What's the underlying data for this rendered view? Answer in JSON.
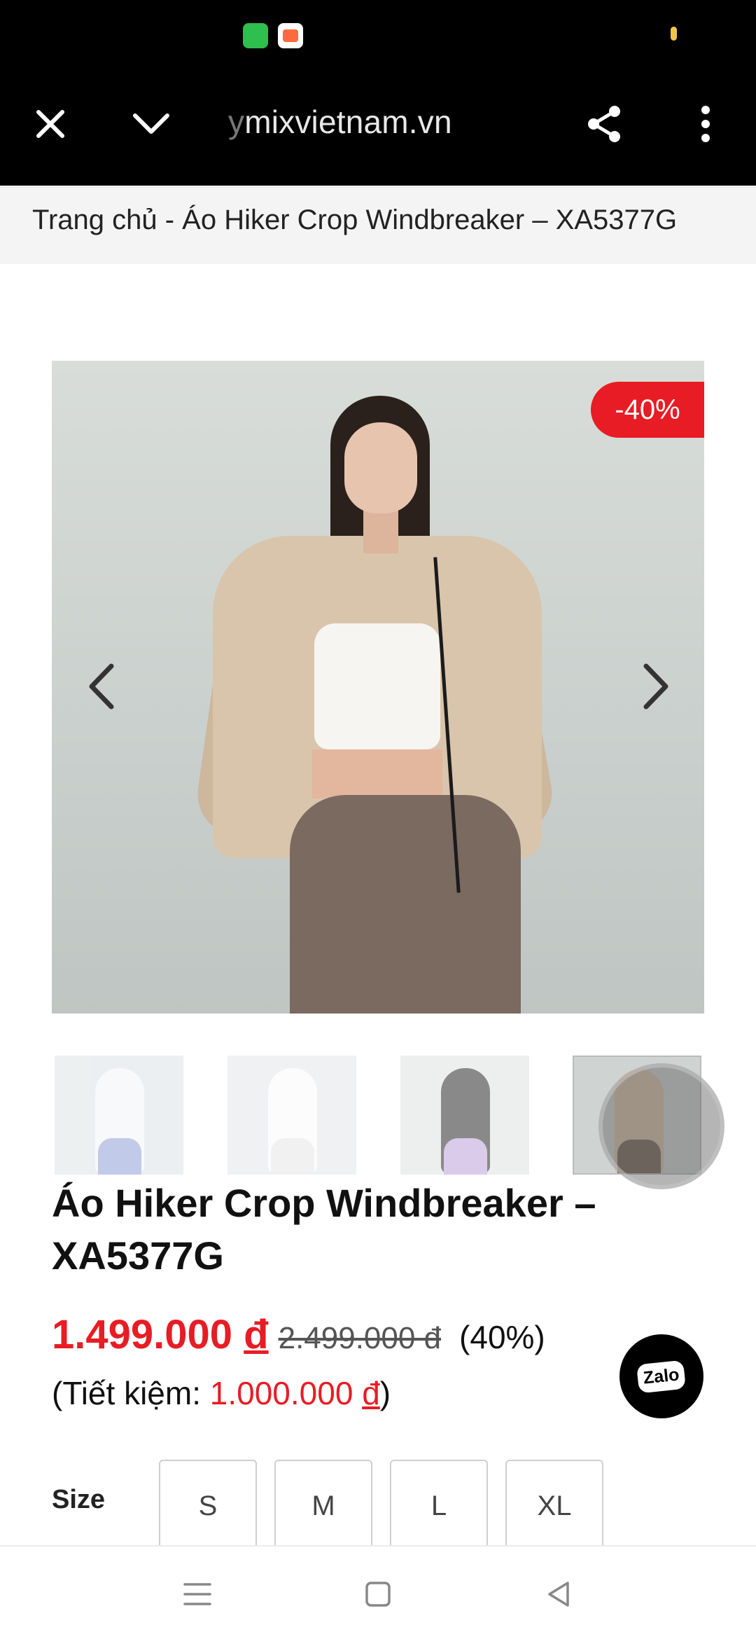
{
  "browser": {
    "url_faded": "y",
    "url_main": "mixvietnam.vn",
    "icons": [
      "close-icon",
      "chevron-down-icon",
      "share-icon",
      "more-vert-icon"
    ]
  },
  "breadcrumb": "Trang chủ - Áo Hiker Crop Windbreaker – XA5377G",
  "gallery": {
    "discount_badge": "-40%",
    "thumbnail_count": 4,
    "active_thumbnail": 4
  },
  "product": {
    "title_line1": "Áo Hiker Crop Windbreaker –",
    "title_line2": "XA5377G",
    "price_new": "1.499.000",
    "price_new_currency": "đ",
    "price_old": "2.499.000 đ",
    "discount_pct": "(40%)",
    "saving_prefix": "(Tiết kiệm: ",
    "saving_amount": "1.000.000",
    "saving_currency": "đ",
    "saving_suffix": ")"
  },
  "size": {
    "label": "Size",
    "options": [
      "S",
      "M",
      "L",
      "XL"
    ]
  },
  "zalo": {
    "label": "Zalo"
  },
  "colors": {
    "accent_red": "#e81c24",
    "toolbar_bg": "#000000"
  }
}
